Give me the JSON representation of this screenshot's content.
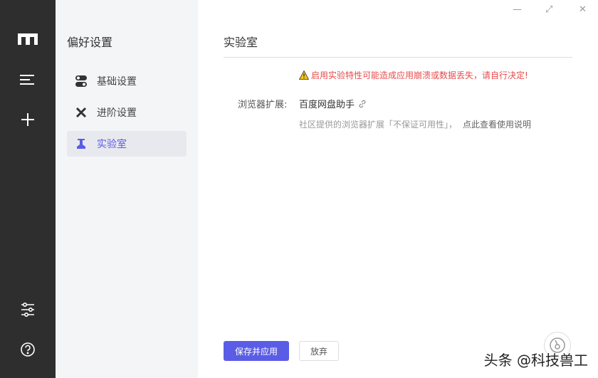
{
  "sidebar": {
    "title": "偏好设置",
    "items": [
      {
        "label": "基础设置"
      },
      {
        "label": "进阶设置"
      },
      {
        "label": "实验室"
      }
    ]
  },
  "main": {
    "title": "实验室",
    "warning": "启用实验特性可能造成应用崩溃或数据丢失，请自行决定!",
    "ext_label": "浏览器扩展:",
    "ext_value": "百度网盘助手",
    "hint": "社区提供的浏览器扩展「不保证可用性」，",
    "hint_link": "点此查看使用说明",
    "save_label": "保存并应用",
    "cancel_label": "放弃"
  },
  "window": {
    "minimize": "—",
    "maximize": "⤢",
    "close": "✕"
  },
  "watermark": "头条 @科技兽工",
  "colors": {
    "accent": "#5b5ce6",
    "warning": "#e84b4b",
    "rail": "#2e2e2e"
  }
}
